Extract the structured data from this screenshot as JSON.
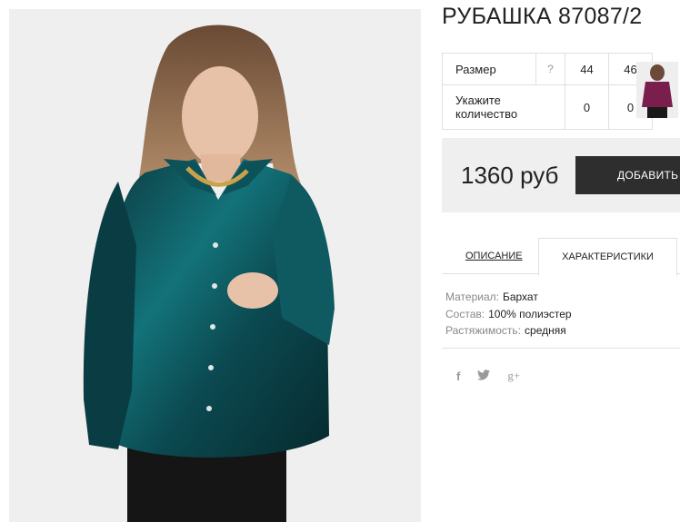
{
  "product": {
    "title": "РУБАШКА 87087/2",
    "image": "product-photo",
    "thumbnail": "product-thumbnail"
  },
  "sizes": {
    "size_label": "Размер",
    "help_glyph": "?",
    "size_values": [
      "44",
      "46"
    ],
    "qty_label_line1": "Укажите",
    "qty_label_line2": "количество",
    "qty_values": [
      "0",
      "0"
    ]
  },
  "purchase": {
    "price": "1360 руб",
    "add_button_label": "ДОБАВИТЬ В КОРЗИНУ",
    "add_button_icon": "shopping-bag-icon"
  },
  "tabs": {
    "description": "ОПИСАНИЕ",
    "characteristics": "ХАРАКТЕРИСТИКИ",
    "active": "characteristics"
  },
  "specs": [
    {
      "key": "Материал:",
      "value": "Бархат"
    },
    {
      "key": "Состав:",
      "value": "100% полиэстер"
    },
    {
      "key": "Растяжимость:",
      "value": "средняя"
    }
  ],
  "social": {
    "facebook": "f",
    "twitter": "twitter-icon",
    "googleplus": "g+"
  },
  "colors": {
    "button_bg": "#2e2e2e",
    "price_bg": "#efefef",
    "shirt": "#0d4a50",
    "border": "#e0e0e0"
  }
}
